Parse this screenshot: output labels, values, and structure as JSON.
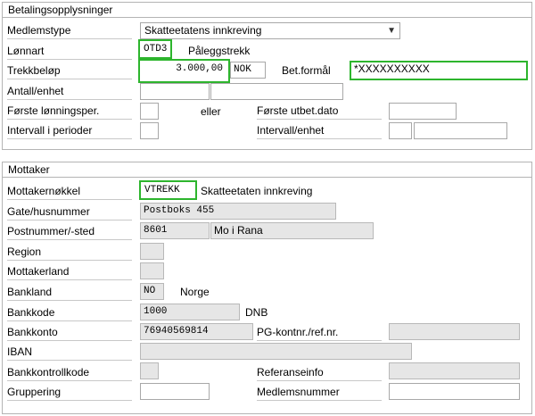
{
  "betaling": {
    "title": "Betalingsopplysninger",
    "medlemstype_label": "Medlemstype",
    "medlemstype_value": "Skatteetatens innkreving",
    "lonnart_label": "Lønnart",
    "lonnart_value": "OTD3",
    "lonnart_text": "Påleggstrekk",
    "trekkbelop_label": "Trekkbeløp",
    "trekkbelop_value": "3.000,00",
    "currency": "NOK",
    "betformal_label": "Bet.formål",
    "betformal_value": "*XXXXXXXXXX",
    "antall_label": "Antall/enhet",
    "forste_lonn_label": "Første lønningsper.",
    "eller": "eller",
    "forste_utbet_label": "Første utbet.dato",
    "intervall_per_label": "Intervall i perioder",
    "intervall_enhet_label": "Intervall/enhet"
  },
  "mottaker": {
    "title": "Mottaker",
    "nokkel_label": "Mottakernøkkel",
    "nokkel_value": "VTREKK",
    "nokkel_text": "Skatteetaten innkreving",
    "gate_label": "Gate/husnummer",
    "gate_value": "Postboks 455",
    "postnr_label": "Postnummer/-sted",
    "postnr_value": "8601",
    "sted_value": "Mo i Rana",
    "region_label": "Region",
    "land_label": "Mottakerland",
    "bankland_label": "Bankland",
    "bankland_value": "NO",
    "bankland_text": "Norge",
    "bankkode_label": "Bankkode",
    "bankkode_value": "1000",
    "bankkode_text": "DNB",
    "bankkonto_label": "Bankkonto",
    "bankkonto_value": "76940569814",
    "pgkontnr_label": "PG-kontnr./ref.nr.",
    "iban_label": "IBAN",
    "kontrollkode_label": "Bankkontrollkode",
    "referanse_label": "Referanseinfo",
    "gruppering_label": "Gruppering",
    "medlemsnr_label": "Medlemsnummer"
  },
  "colors": {
    "highlight": "#2db52d",
    "readonly_bg": "#e6e6e6"
  },
  "icons": {
    "dropdown": "chevron-down-icon"
  }
}
